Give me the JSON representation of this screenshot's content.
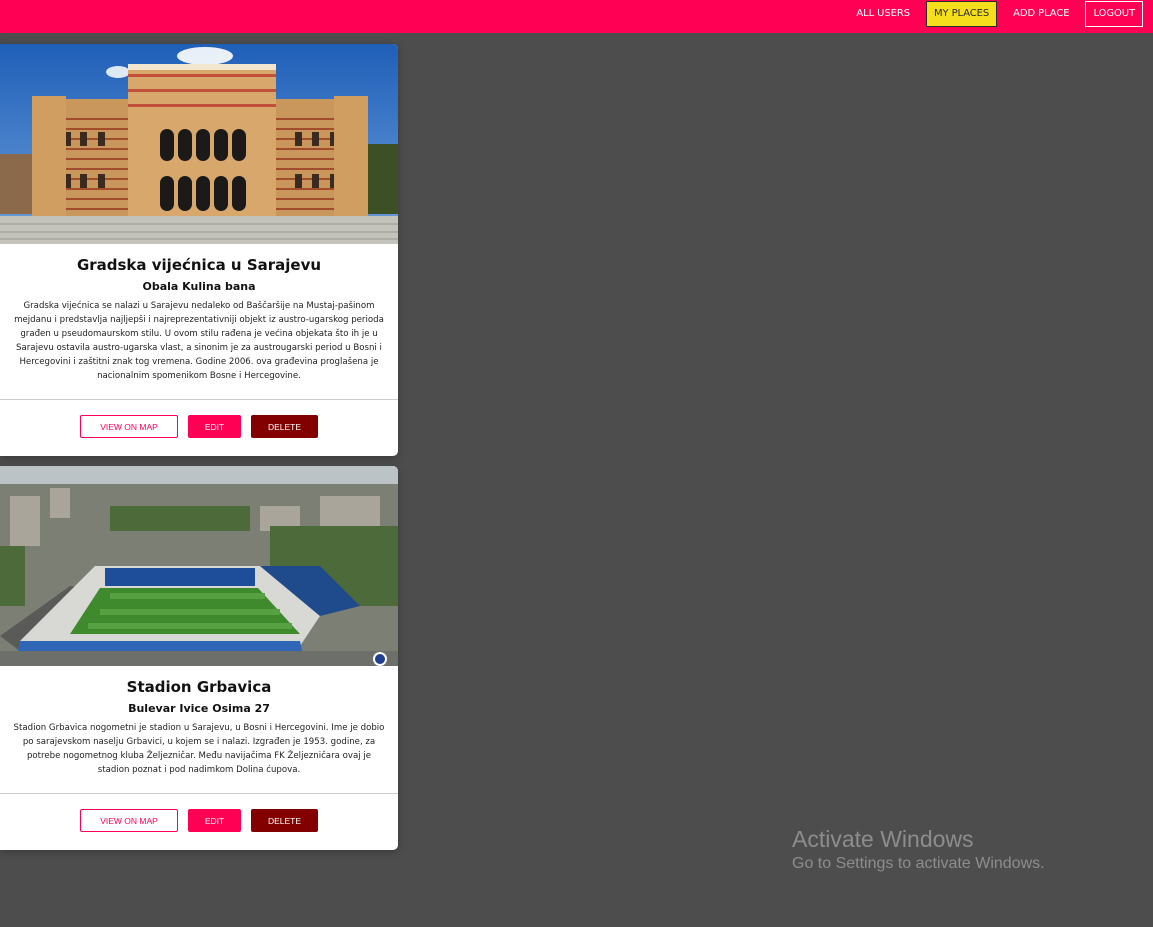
{
  "nav": {
    "all_users": "ALL USERS",
    "my_places": "MY PLACES",
    "add_place": "ADD PLACE",
    "logout": "LOGOUT"
  },
  "places": [
    {
      "title": "Gradska vijećnica u Sarajevu",
      "address": "Obala Kulina bana",
      "description": "Gradska vijećnica se nalazi u Sarajevu nedaleko od Baščaršije na Mustaj-pašinom mejdanu i predstavlja najljepši i najreprezentativniji objekt iz austro-ugarskog perioda građen u pseudomaurskom stilu. U ovom stilu rađena je većina objekata što ih je u Sarajevu ostavila austro-ugarska vlast, a sinonim je za austrougarski period u Bosni i Hercegovini i zaštitni znak tog vremena. Godine 2006. ova građevina proglašena je nacionalnim spomenikom Bosne i Hercegovine.",
      "buttons": {
        "view": "VIEW ON MAP",
        "edit": "EDIT",
        "delete": "DELETE"
      }
    },
    {
      "title": "Stadion Grbavica",
      "address": "Bulevar Ivice Osima 27",
      "description": "Stadion Grbavica nogometni je stadion u Sarajevu, u Bosni i Hercegovini. Ime je dobio po sarajevskom naselju Grbavici, u kojem se i nalazi. Izgrađen je 1953. godine, za potrebe nogometnog kluba Željezničar. Među navijačima FK Željezničara ovaj je stadion poznat i pod nadimkom Dolina ćupova.",
      "buttons": {
        "view": "VIEW ON MAP",
        "edit": "EDIT",
        "delete": "DELETE"
      }
    }
  ],
  "watermark": {
    "title": "Activate Windows",
    "subtitle": "Go to Settings to activate Windows."
  },
  "colors": {
    "brand": "#ff0055",
    "active_nav": "#f5de1b",
    "delete": "#830000",
    "background": "#4d4d4d"
  }
}
